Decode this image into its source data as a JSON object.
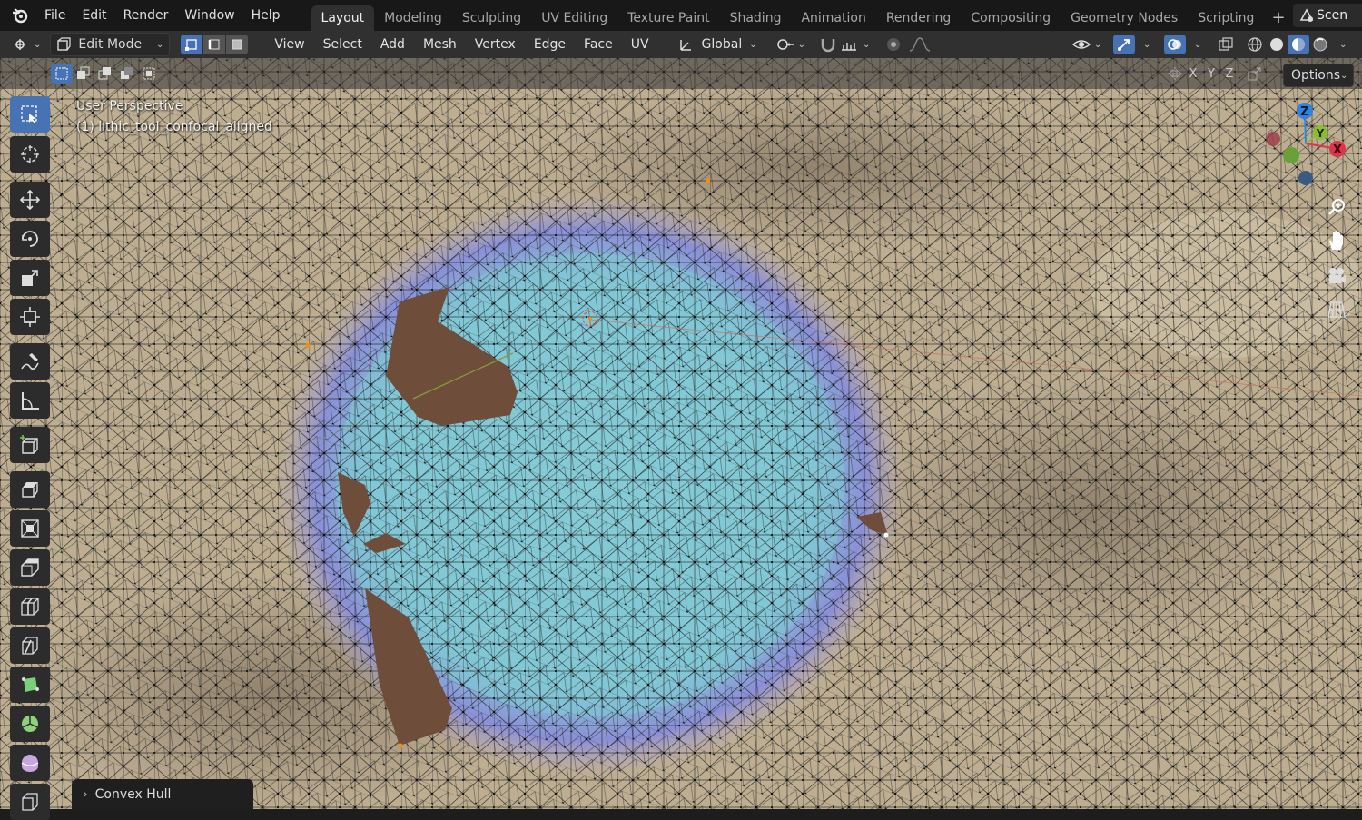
{
  "topbar": {
    "menus": [
      "File",
      "Edit",
      "Render",
      "Window",
      "Help"
    ],
    "workspaces": [
      "Layout",
      "Modeling",
      "Sculpting",
      "UV Editing",
      "Texture Paint",
      "Shading",
      "Animation",
      "Rendering",
      "Compositing",
      "Geometry Nodes",
      "Scripting"
    ],
    "active_workspace": "Layout",
    "add_workspace": "+",
    "scene_label": "Scen"
  },
  "header": {
    "mode": "Edit Mode",
    "menus": [
      "View",
      "Select",
      "Add",
      "Mesh",
      "Vertex",
      "Edge",
      "Face",
      "UV"
    ],
    "orientation": "Global"
  },
  "subheader": {
    "axes": [
      "X",
      "Y",
      "Z"
    ],
    "options_label": "Options"
  },
  "viewport": {
    "perspective_label": "User Perspective",
    "object_label": "(1) lithic_tool_confocal_aligned",
    "gizmo_axes": {
      "x": "X",
      "y": "Y",
      "z": "Z"
    }
  },
  "operator_panel": {
    "label": "Convex Hull",
    "chevron": "›"
  },
  "colors": {
    "accent": "#4772b3",
    "x_axis": "#e1334d",
    "y_axis": "#8bbe2f",
    "z_axis": "#2f83e1"
  }
}
